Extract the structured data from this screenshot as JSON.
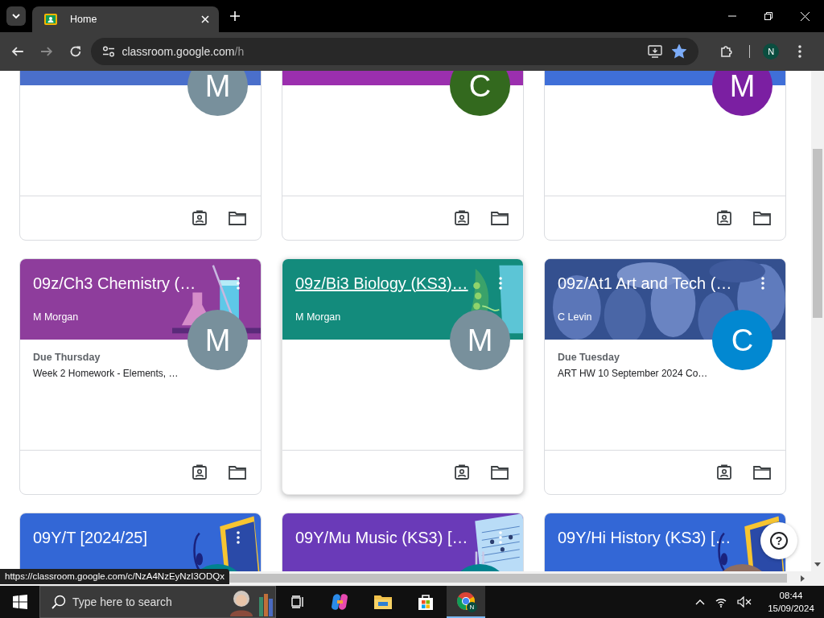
{
  "browser": {
    "tab_title": "Home",
    "url_host": "classroom.google.com",
    "url_path": "/h",
    "bookmarked": true,
    "profile": "N"
  },
  "courses": [
    {
      "color": "#4a6fcb",
      "avatar": {
        "letter": "M",
        "color": "#78909c"
      },
      "hovered": false
    },
    {
      "color": "#9b2fae",
      "avatar": {
        "letter": "C",
        "color": "#33691e"
      },
      "hovered": false
    },
    {
      "color": "#3f6fd8",
      "avatar": {
        "letter": "M",
        "color": "#7b1fa2"
      },
      "hovered": false
    },
    {
      "kind": "chemistry",
      "title": "09z/Ch3 Chemistry (…",
      "more_button": true,
      "teacher": "M Morgan",
      "color": "#8e3d9c",
      "avatar": {
        "letter": "M",
        "color": "#78909c"
      },
      "due": "Due Thursday",
      "assignment": "Week 2 Homework - Elements, …",
      "hovered": false
    },
    {
      "kind": "biology",
      "title": "09z/Bi3 Biology (KS3)…",
      "more_button": true,
      "teacher": "M Morgan",
      "color": "#138b7c",
      "avatar": {
        "letter": "M",
        "color": "#78909c"
      },
      "hovered": true
    },
    {
      "title": "09z/At1 Art and Tech (…",
      "more_button": true,
      "teacher": "C Levin",
      "avatar": {
        "letter": "C",
        "color": "#0288d1"
      },
      "due": "Due Tuesday",
      "assignment": "ART HW 10 September 2024 Co…",
      "hovered": false
    },
    {
      "kind": "headphones",
      "title": "09Y/T [2024/25]",
      "more_button": true,
      "color": "#3367d6",
      "avatar": {
        "color": "#00838f"
      },
      "hovered": false
    },
    {
      "kind": "music",
      "title": "09Y/Mu Music (KS3) […",
      "more_button": true,
      "color": "#6a3ab8",
      "avatar": {
        "color": "#00838f"
      },
      "hovered": false
    },
    {
      "kind": "headphones",
      "title": "09Y/Hi History (KS3) […",
      "more_button": false,
      "color": "#3367d6",
      "avatar": {
        "color": "#8d6e63"
      },
      "hovered": false
    }
  ],
  "help": "?",
  "status_url": "https://classroom.google.com/c/NzA4NzEyNzI3ODQx",
  "taskbar": {
    "search_placeholder": "Type here to search",
    "chrome_badge": "N",
    "time": "08:44",
    "date": "15/09/2024"
  }
}
